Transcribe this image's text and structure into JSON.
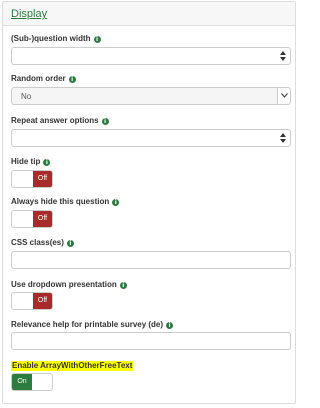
{
  "panel": {
    "title": "Display"
  },
  "fields": {
    "subquestion_width": {
      "label": "(Sub-)question width",
      "value": ""
    },
    "random_order": {
      "label": "Random order",
      "selected": "No"
    },
    "repeat_answer_options": {
      "label": "Repeat answer options",
      "value": ""
    },
    "hide_tip": {
      "label": "Hide tip",
      "state": "Off"
    },
    "always_hide": {
      "label": "Always hide this question",
      "state": "Off"
    },
    "css_class": {
      "label": "CSS class(es)",
      "value": ""
    },
    "dropdown_presentation": {
      "label": "Use dropdown presentation",
      "state": "Off"
    },
    "relevance_help": {
      "label": "Relevance help for printable survey (de)",
      "value": ""
    },
    "enable_other_free_text": {
      "label": "Enable ArrayWithOtherFreeText",
      "state": "On"
    }
  },
  "icons": {
    "info": "info-icon",
    "chevron": "chevron-down-icon",
    "spinner": "number-spinner"
  },
  "colors": {
    "accent": "#2c7c3f",
    "off": "#a72b2b",
    "highlight": "#ffff00"
  },
  "info_glyph": "i"
}
